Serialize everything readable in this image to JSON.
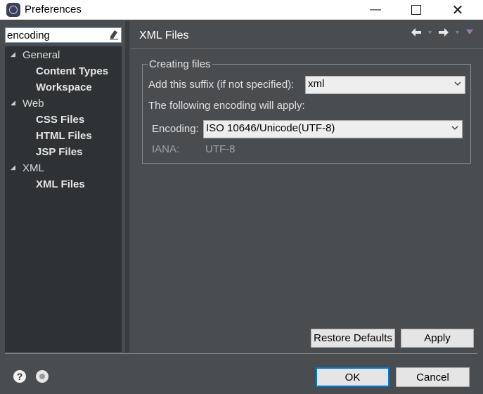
{
  "window": {
    "title": "Preferences",
    "minimize": "—",
    "close": "✕"
  },
  "filter": {
    "value": "encoding"
  },
  "tree": [
    {
      "label": "General",
      "level": 0,
      "expanded": true
    },
    {
      "label": "Content Types",
      "level": 1
    },
    {
      "label": "Workspace",
      "level": 1
    },
    {
      "label": "Web",
      "level": 0,
      "expanded": true
    },
    {
      "label": "CSS Files",
      "level": 1
    },
    {
      "label": "HTML Files",
      "level": 1
    },
    {
      "label": "JSP Files",
      "level": 1
    },
    {
      "label": "XML",
      "level": 0,
      "expanded": true
    },
    {
      "label": "XML Files",
      "level": 1,
      "selected": true
    }
  ],
  "page": {
    "title": "XML Files",
    "group_title": "Creating files",
    "suffix_label": "Add this suffix (if not specified):",
    "suffix_value": "xml",
    "encoding_note": "The following encoding will apply:",
    "encoding_label": "Encoding:",
    "encoding_value": "ISO 10646/Unicode(UTF-8)",
    "iana_label": "IANA:",
    "iana_value": "UTF-8"
  },
  "buttons": {
    "restore_defaults": "Restore Defaults",
    "apply": "Apply",
    "ok": "OK",
    "cancel": "Cancel"
  },
  "icons": {
    "back": "arrow-left-icon",
    "forward": "arrow-right-icon",
    "menu": "view-menu-icon",
    "help": "?",
    "import": "import-export-icon"
  },
  "colors": {
    "background": "#4a4d50",
    "tree_background": "#2f3234",
    "ok_border": "#0078d7"
  }
}
